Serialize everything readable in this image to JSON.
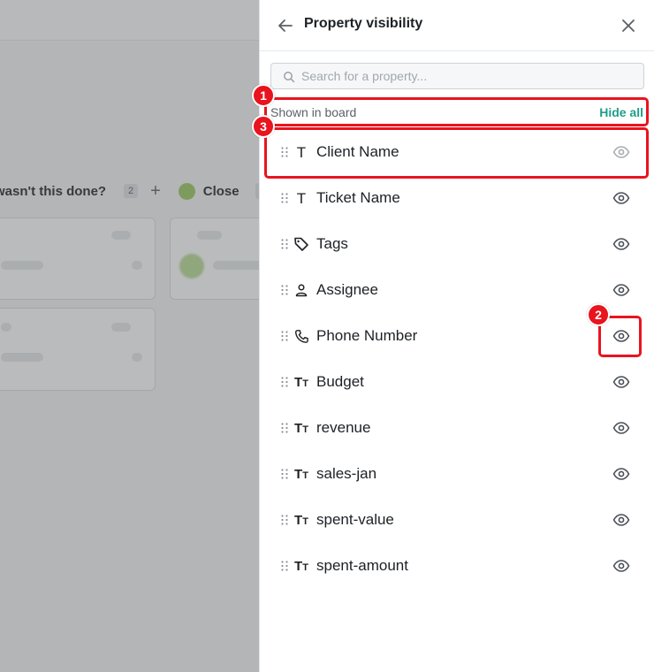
{
  "board": {
    "group_title": "wasn't this done?",
    "group_count": "2",
    "add_symbol": "+",
    "next_group_label": "Close",
    "next_group_color": "#97c95c"
  },
  "panel": {
    "title": "Property visibility",
    "back_icon": "arrow-left-icon",
    "close_icon": "close-icon",
    "search": {
      "placeholder": "Search for a property..."
    },
    "section_label": "Shown in board",
    "hide_all_label": "Hide all",
    "accent_color": "#1f9e8a",
    "properties": [
      {
        "name": "Client Name",
        "type_icon": "text-icon",
        "visible_icon": "eye-icon"
      },
      {
        "name": "Ticket Name",
        "type_icon": "text-icon",
        "visible_icon": "eye-icon"
      },
      {
        "name": "Tags",
        "type_icon": "tag-icon",
        "visible_icon": "eye-icon"
      },
      {
        "name": "Assignee",
        "type_icon": "person-icon",
        "visible_icon": "eye-icon"
      },
      {
        "name": "Phone Number",
        "type_icon": "phone-icon",
        "visible_icon": "eye-icon"
      },
      {
        "name": "Budget",
        "type_icon": "text-size-icon",
        "visible_icon": "eye-icon"
      },
      {
        "name": "revenue",
        "type_icon": "text-size-icon",
        "visible_icon": "eye-icon"
      },
      {
        "name": "sales-jan",
        "type_icon": "text-size-icon",
        "visible_icon": "eye-icon"
      },
      {
        "name": "spent-value",
        "type_icon": "text-size-icon",
        "visible_icon": "eye-icon"
      },
      {
        "name": "spent-amount",
        "type_icon": "text-size-icon",
        "visible_icon": "eye-icon"
      }
    ]
  },
  "annotations": {
    "color": "#e8141e",
    "steps": [
      "1",
      "2",
      "3"
    ]
  }
}
